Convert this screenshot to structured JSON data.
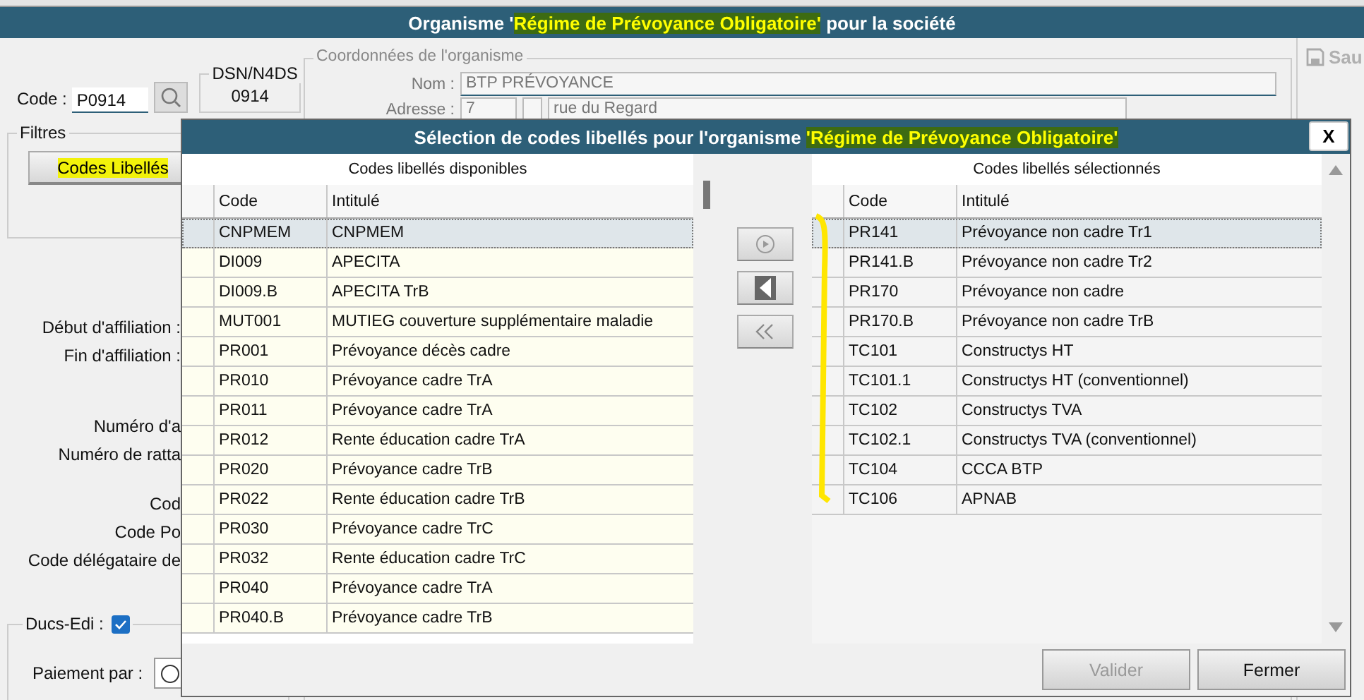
{
  "window": {
    "title_prefix": "Organisme '",
    "title_highlight": "Régime de Prévoyance Obligatoire'",
    "title_suffix": " pour la société"
  },
  "toolbar": {
    "save_label": "Sau",
    "disabled": true
  },
  "form": {
    "code_label": "Code :",
    "code_value": "P0914",
    "dsn_title": "DSN/N4DS",
    "dsn_value": "0914",
    "filters_title": "Filtres",
    "filters_button": {
      "label": "Codes Libellés",
      "highlighted": true
    },
    "org_title": "Coordonnées de l'organisme",
    "nom_label": "Nom :",
    "nom_value": "BTP PRÉVOYANCE",
    "adresse_label": "Adresse :",
    "adresse_number": "7",
    "adresse_street": "rue du Regard",
    "labels": [
      "Début d'affiliation :",
      "Fin d'affiliation :",
      "Numéro d'a",
      "Numéro de ratta",
      "Cod",
      "Code Po",
      "Code délégataire de"
    ],
    "ducs_label": "Ducs-Edi :",
    "ducs_checked": true,
    "paiement_label": "Paiement par :",
    "paiement_option_selected": false
  },
  "dialog": {
    "title_prefix": "Sélection de codes libellés pour l'organisme ",
    "title_highlight": "'Régime de Prévoyance Obligatoire'",
    "close": "X",
    "available": {
      "title": "Codes libellés disponibles",
      "columns": [
        "Code",
        "Intitulé"
      ],
      "rows": [
        {
          "code": "CNPMEM",
          "label": "CNPMEM",
          "selected": true
        },
        {
          "code": "DI009",
          "label": "APECITA",
          "selected": false
        },
        {
          "code": "DI009.B",
          "label": "APECITA TrB",
          "selected": false
        },
        {
          "code": "MUT001",
          "label": "MUTIEG couverture supplémentaire maladie",
          "selected": false
        },
        {
          "code": "PR001",
          "label": "Prévoyance décès cadre",
          "selected": false
        },
        {
          "code": "PR010",
          "label": "Prévoyance cadre TrA",
          "selected": false
        },
        {
          "code": "PR011",
          "label": "Prévoyance cadre TrA",
          "selected": false
        },
        {
          "code": "PR012",
          "label": "Rente éducation cadre TrA",
          "selected": false
        },
        {
          "code": "PR020",
          "label": "Prévoyance cadre TrB",
          "selected": false
        },
        {
          "code": "PR022",
          "label": "Rente éducation cadre TrB",
          "selected": false
        },
        {
          "code": "PR030",
          "label": "Prévoyance cadre TrC",
          "selected": false
        },
        {
          "code": "PR032",
          "label": "Rente éducation cadre TrC",
          "selected": false
        },
        {
          "code": "PR040",
          "label": "Prévoyance cadre TrA",
          "selected": false
        },
        {
          "code": "PR040.B",
          "label": "Prévoyance cadre TrB",
          "selected": false
        }
      ]
    },
    "chosen": {
      "title": "Codes libellés sélectionnés",
      "columns": [
        "Code",
        "Intitulé"
      ],
      "rows": [
        {
          "code": "PR141",
          "label": "Prévoyance non cadre Tr1",
          "selected": true
        },
        {
          "code": "PR141.B",
          "label": "Prévoyance non cadre Tr2",
          "selected": false
        },
        {
          "code": "PR170",
          "label": "Prévoyance non cadre",
          "selected": false
        },
        {
          "code": "PR170.B",
          "label": "Prévoyance non cadre TrB",
          "selected": false
        },
        {
          "code": "TC101",
          "label": "Constructys HT",
          "selected": false
        },
        {
          "code": "TC101.1",
          "label": "Constructys HT (conventionnel)",
          "selected": false
        },
        {
          "code": "TC102",
          "label": "Constructys TVA",
          "selected": false
        },
        {
          "code": "TC102.1",
          "label": "Constructys TVA (conventionnel)",
          "selected": false
        },
        {
          "code": "TC104",
          "label": "CCCA BTP",
          "selected": false
        },
        {
          "code": "TC106",
          "label": "APNAB",
          "selected": false
        }
      ]
    },
    "validate": {
      "label": "Valider",
      "disabled": true
    },
    "close_button": {
      "label": "Fermer",
      "disabled": false
    }
  }
}
